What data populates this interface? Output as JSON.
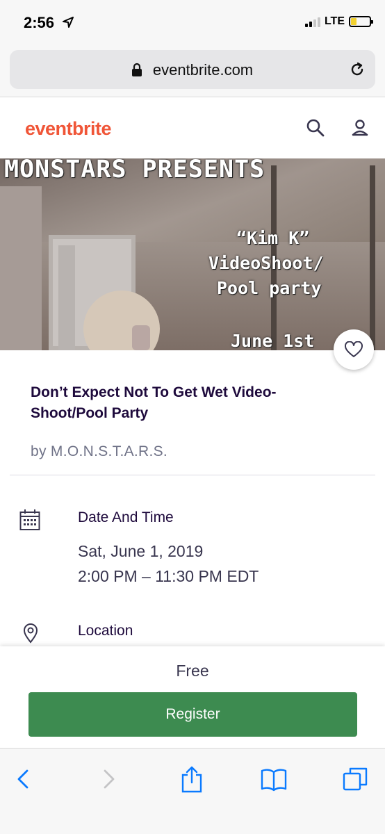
{
  "status": {
    "time": "2:56",
    "network": "LTE"
  },
  "browser": {
    "url": "eventbrite.com"
  },
  "header": {
    "logo": "eventbrite"
  },
  "hero": {
    "title": "MONSTARS PRESENTS",
    "line1": "“Kim K”",
    "line2": "VideoShoot/",
    "line3": "Pool party",
    "line4": "June 1st"
  },
  "event": {
    "title": "Don’t Expect Not To Get Wet Video-Shoot/Pool Party",
    "organizer": "by M.O.N.S.T.A.R.S.",
    "datetime_label": "Date And Time",
    "date": "Sat, June 1, 2019",
    "time": "2:00 PM – 11:30 PM EDT",
    "location_label": "Location"
  },
  "registration": {
    "price": "Free",
    "button": "Register"
  },
  "colors": {
    "brand": "#f05537",
    "register": "#3d8b50",
    "ios_blue": "#0a7aff"
  },
  "icons": [
    "location-arrow-icon",
    "lock-icon",
    "reload-icon",
    "search-icon",
    "user-icon",
    "heart-icon",
    "calendar-icon",
    "map-pin-icon",
    "back-icon",
    "forward-icon",
    "share-icon",
    "bookmarks-icon",
    "tabs-icon"
  ]
}
